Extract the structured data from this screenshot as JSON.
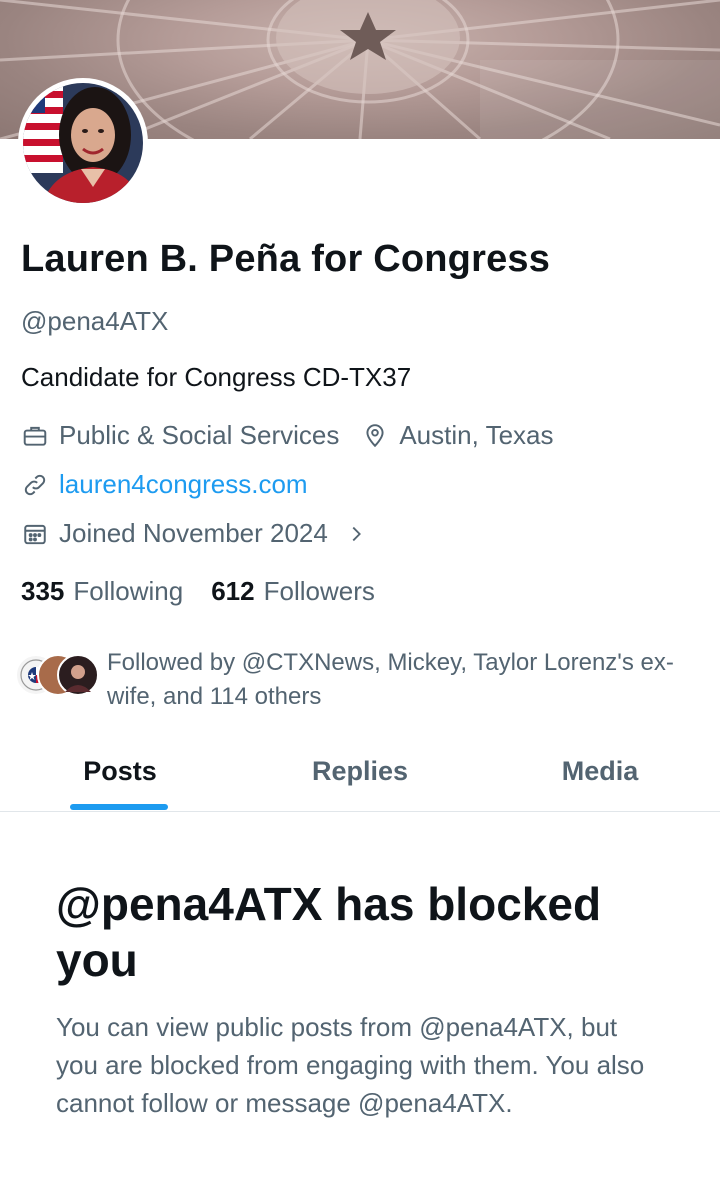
{
  "profile": {
    "name": "Lauren B. Peña for Congress",
    "handle": "@pena4ATX",
    "bio": "Candidate for Congress CD-TX37",
    "category": "Public & Social Services",
    "location": "Austin, Texas",
    "website": "lauren4congress.com",
    "joined": "Joined November 2024"
  },
  "icons": {
    "category": "briefcase-icon",
    "location": "map-pin-icon",
    "website": "link-icon",
    "joined": "calendar-icon",
    "joined_more": "chevron-right-icon"
  },
  "counts": {
    "following_value": "335",
    "following_label": "Following",
    "followers_value": "612",
    "followers_label": "Followers"
  },
  "followed_by": {
    "text": "Followed by @CTXNews, Mickey, Taylor Lorenz's ex-wife, and 114 others"
  },
  "tabs": [
    {
      "label": "Posts",
      "active": true
    },
    {
      "label": "Replies",
      "active": false
    },
    {
      "label": "Media",
      "active": false
    }
  ],
  "blocked": {
    "title": "@pena4ATX has blocked you",
    "body": "You can view public posts from @pena4ATX, but you are blocked from engaging with them. You also cannot follow or message @pena4ATX."
  },
  "colors": {
    "accent": "#1d9bf0",
    "text_primary": "#0f1419",
    "text_secondary": "#536471"
  }
}
